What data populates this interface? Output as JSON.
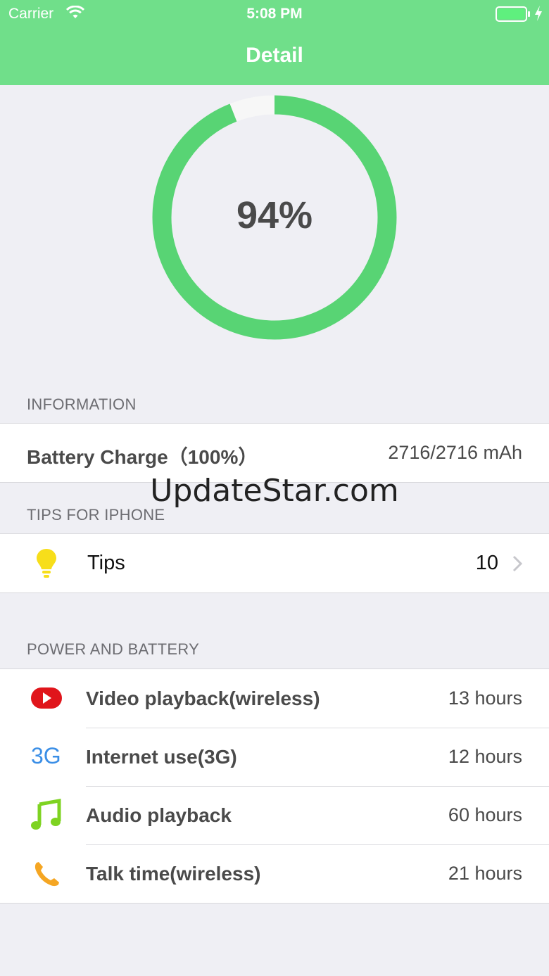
{
  "status_bar": {
    "carrier": "Carrier",
    "time": "5:08 PM"
  },
  "nav": {
    "title": "Detail"
  },
  "gauge": {
    "label": "94%",
    "level": 0.94,
    "color": "#58d474",
    "track": "#f7f7f7"
  },
  "information": {
    "header": "INFORMATION",
    "row": {
      "label": "Battery Charge（100%）",
      "value": "2716/2716 mAh"
    }
  },
  "tips": {
    "header": "TIPS FOR IPHONE",
    "row": {
      "label": "Tips",
      "count": "10"
    }
  },
  "power": {
    "header": "POWER AND BATTERY",
    "rows": [
      {
        "label": "Video playback(wireless)",
        "value": "13 hours",
        "icon": "video-play-icon"
      },
      {
        "label": "Internet use(3G)",
        "value": "12 hours",
        "icon": "3g-icon",
        "icon_text": "3G"
      },
      {
        "label": "Audio playback",
        "value": "60 hours",
        "icon": "music-note-icon"
      },
      {
        "label": "Talk time(wireless)",
        "value": "21 hours",
        "icon": "phone-icon"
      }
    ]
  },
  "watermark": "UpdateStar.com",
  "colors": {
    "nav_bg": "#70df8a",
    "page_bg": "#efeff4",
    "accent_green": "#58d474"
  }
}
